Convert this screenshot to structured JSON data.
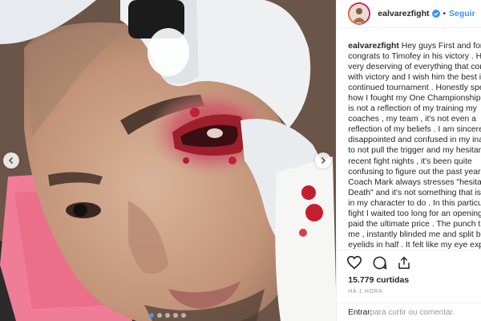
{
  "post": {
    "username": "ealvarezfight",
    "follow_label": "Seguir",
    "separator": "•",
    "caption_lines": [
      "Hey guys First and forem",
      "congrats to Timofey in his victory . He",
      "very deserving of everything that com",
      "with victory and I wish him the best in",
      "continued tournament . Honestly spea",
      "how I fought my One Championship d",
      "is not a reflection of my training my",
      "coaches , my team , it's not even a",
      "reflection of my beliefs . I am sincerely",
      "disappointed and confused in my inab",
      "to not pull the trigger and my hesitan",
      "recent fight nights , it's been quite",
      "confusing to figure out the past year c",
      "Coach Mark always stresses \"hesitancy",
      "Death\" and it's not something that is c",
      "in my character to do . In this particula",
      "fight I waited too long for an opening",
      "paid the ultimate price . The punch th",
      "me , instantly blinded me and split bo",
      "eyelids in half . It felt like my eye explo"
    ],
    "likes": "15.779 curtidas",
    "time": "HÁ 1 HORA",
    "login_link": "Entrar",
    "comment_prompt": " para curtir ou comentar."
  },
  "icons": {
    "like": "heart-icon",
    "comment": "comment-icon",
    "share": "share-icon",
    "verified": "verified-badge-icon",
    "prev": "chevron-left-icon",
    "next": "chevron-right-icon"
  },
  "carousel": {
    "total_slides": 5,
    "active_slide": 1
  },
  "colors": {
    "link": "#3897f0",
    "text": "#262626",
    "muted": "#999999",
    "border": "#efefef"
  }
}
